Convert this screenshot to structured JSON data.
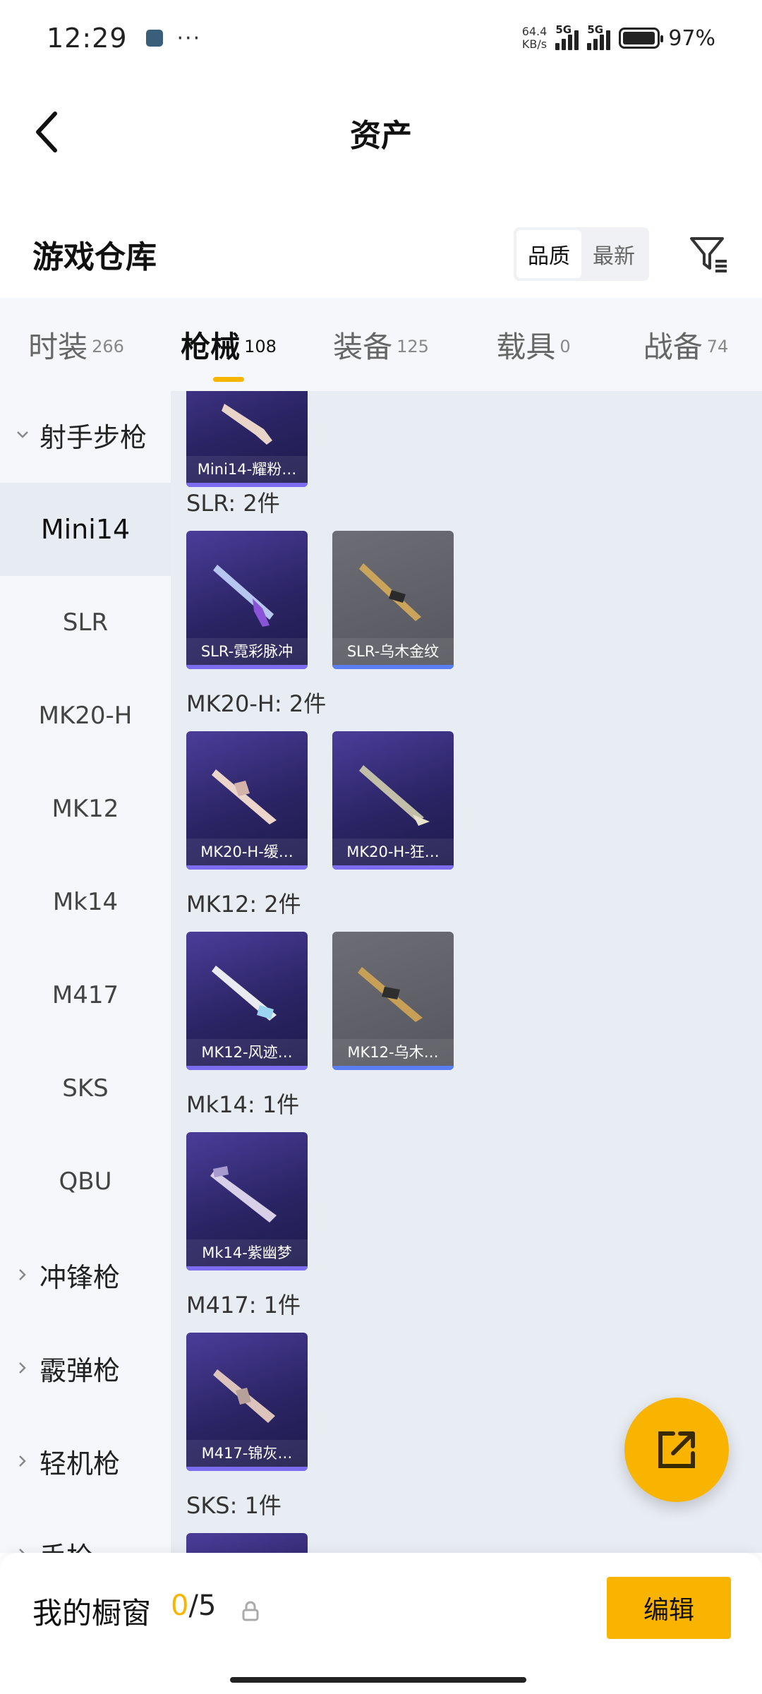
{
  "status_bar": {
    "time": "12:29",
    "more": "···",
    "net_speed_value": "64.4",
    "net_speed_unit": "KB/s",
    "signal1_label": "5G",
    "signal2_label": "5G",
    "battery": "97%",
    "battery_level": 0.97
  },
  "header": {
    "title": "资产",
    "back_icon": "chevron-left-icon"
  },
  "warehouse": {
    "title": "游戏仓库",
    "sort_options": [
      "品质",
      "最新"
    ],
    "sort_selected": "品质",
    "filter_icon": "filter-icon"
  },
  "tabs": [
    {
      "label": "时装",
      "count": "266"
    },
    {
      "label": "枪械",
      "count": "108"
    },
    {
      "label": "装备",
      "count": "125"
    },
    {
      "label": "载具",
      "count": "0"
    },
    {
      "label": "战备",
      "count": "74"
    }
  ],
  "active_tab": "枪械",
  "sidebar": {
    "group_open": "射手步枪",
    "items": [
      "Mini14",
      "SLR",
      "MK20-H",
      "MK12",
      "Mk14",
      "M417",
      "SKS",
      "QBU"
    ],
    "active_item": "Mini14",
    "groups_closed": [
      "冲锋枪",
      "霰弹枪",
      "轻机枪",
      "手枪"
    ]
  },
  "content": {
    "top_partial_item": "Mini14-耀粉…",
    "groups": [
      {
        "title": "SLR: 2件",
        "items": [
          {
            "label": "SLR-霓彩脉冲",
            "tone": "purple"
          },
          {
            "label": "SLR-乌木金纹",
            "tone": "gray"
          }
        ]
      },
      {
        "title": "MK20-H: 2件",
        "items": [
          {
            "label": "MK20-H-缓…",
            "tone": "purple"
          },
          {
            "label": "MK20-H-狂…",
            "tone": "purple"
          }
        ]
      },
      {
        "title": "MK12: 2件",
        "items": [
          {
            "label": "MK12-风迹…",
            "tone": "purple"
          },
          {
            "label": "MK12-乌木…",
            "tone": "gray"
          }
        ]
      },
      {
        "title": "Mk14: 1件",
        "items": [
          {
            "label": "Mk14-紫幽梦",
            "tone": "purple"
          }
        ]
      },
      {
        "title": "M417: 1件",
        "items": [
          {
            "label": "M417-锦灰…",
            "tone": "purple"
          }
        ]
      },
      {
        "title": "SKS: 1件",
        "items": []
      }
    ]
  },
  "fab": {
    "icon": "share-external-icon"
  },
  "showcase": {
    "title": "我的橱窗",
    "current": "0",
    "separator": "/",
    "total": "5",
    "lock_icon": "lock-icon",
    "edit_label": "编辑"
  },
  "colors": {
    "accent": "#f8b400",
    "purple_card": "#2b2464",
    "gray_card": "#5a5a62",
    "sidebar_bg": "#f5f7fb",
    "content_bg": "#e8ecf3"
  }
}
